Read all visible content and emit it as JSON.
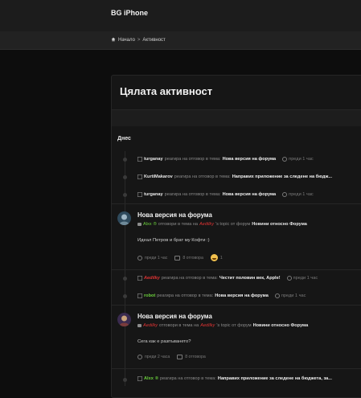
{
  "header": {
    "brand": "BG iPhone"
  },
  "breadcrumb": {
    "home": "Начало",
    "sep": ">",
    "current": "Активност"
  },
  "page": {
    "title": "Цялата активност",
    "day": "Днес"
  },
  "feed": {
    "r1": {
      "user": "turganay",
      "text": "реагира на отговор в тема:",
      "title": "Нова версия на форума",
      "time": "преди 1 час"
    },
    "r2": {
      "user": "KurtiMakarov",
      "text": "реагира на отговор в тема:",
      "title": "Направих приложение за следене на бюдж..."
    },
    "r3": {
      "user": "turganay",
      "text": "реагира на отговор в тема:",
      "title": "Нова версия на форума",
      "time": "преди 1 час"
    },
    "c1": {
      "title": "Нова версия на форума",
      "user": "Alxx",
      "mark": "®",
      "action": "отговори в тема на",
      "owner": "Aedilky",
      "topic_suffix": "'s topic от форум",
      "forum": "Новини относно Форума",
      "text": "Идеал Петров и брат му Кофти :)",
      "time": "преди 1 час",
      "replies": "8 отговора",
      "reaction_count": "1"
    },
    "r4": {
      "user": "Aedilky",
      "text": "реагира на отговор в тема:",
      "title": "Честит половин век, Apple!",
      "time": "преди 1 час"
    },
    "r5": {
      "user": "robot",
      "text": "реагира на отговор в тема:",
      "title": "Нова версия на форума",
      "time": "преди 1 час"
    },
    "c2": {
      "title": "Нова версия на форума",
      "user": "Aedilky",
      "action": "отговори в тема на",
      "owner": "Aedilky",
      "topic_suffix": "'s topic от форум",
      "forum": "Новини относно Форума",
      "text": "Сега как е разпъването?",
      "time": "преди 2 часа",
      "replies": "8 отговора"
    },
    "r6": {
      "user": "Alxx",
      "mark": "®",
      "text": "реагира на отговор в тема:",
      "title": "Направих приложение за следене на бюджета, за..."
    }
  },
  "colors": {
    "accent_red": "#dd3333",
    "accent_green": "#6bcf3c",
    "bg": "#0d0d0d"
  }
}
